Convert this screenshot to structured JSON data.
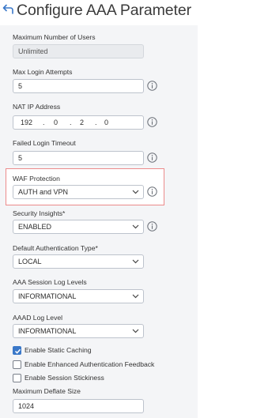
{
  "header": {
    "title": "Configure AAA Parameter",
    "back_icon": "back-arrow-icon"
  },
  "fields": {
    "max_users": {
      "label": "Maximum Number of Users",
      "value": "Unlimited"
    },
    "max_login": {
      "label": "Max Login Attempts",
      "value": "5"
    },
    "nat_ip": {
      "label": "NAT IP Address",
      "octets": [
        "192",
        "0",
        "2",
        "0"
      ]
    },
    "failed_timeout": {
      "label": "Failed Login Timeout",
      "value": "5"
    },
    "waf": {
      "label": "WAF Protection",
      "value": "AUTH and VPN"
    },
    "insights": {
      "label": "Security Insights*",
      "value": "ENABLED"
    },
    "default_auth": {
      "label": "Default Authentication Type*",
      "value": "LOCAL"
    },
    "aaa_session_log": {
      "label": "AAA Session Log Levels",
      "value": "INFORMATIONAL"
    },
    "aaad_log": {
      "label": "AAAD Log Level",
      "value": "INFORMATIONAL"
    },
    "max_deflate": {
      "label": "Maximum Deflate Size",
      "value": "1024"
    }
  },
  "checkboxes": [
    {
      "label": "Enable Static Caching",
      "checked": true
    },
    {
      "label": "Enable Enhanced Authentication Feedback",
      "checked": false
    },
    {
      "label": "Enable Session Stickiness",
      "checked": false
    }
  ],
  "colors": {
    "accent": "#3a78c9",
    "highlight_border": "#ec8b8b",
    "panel_bg": "#f4f5f7"
  }
}
